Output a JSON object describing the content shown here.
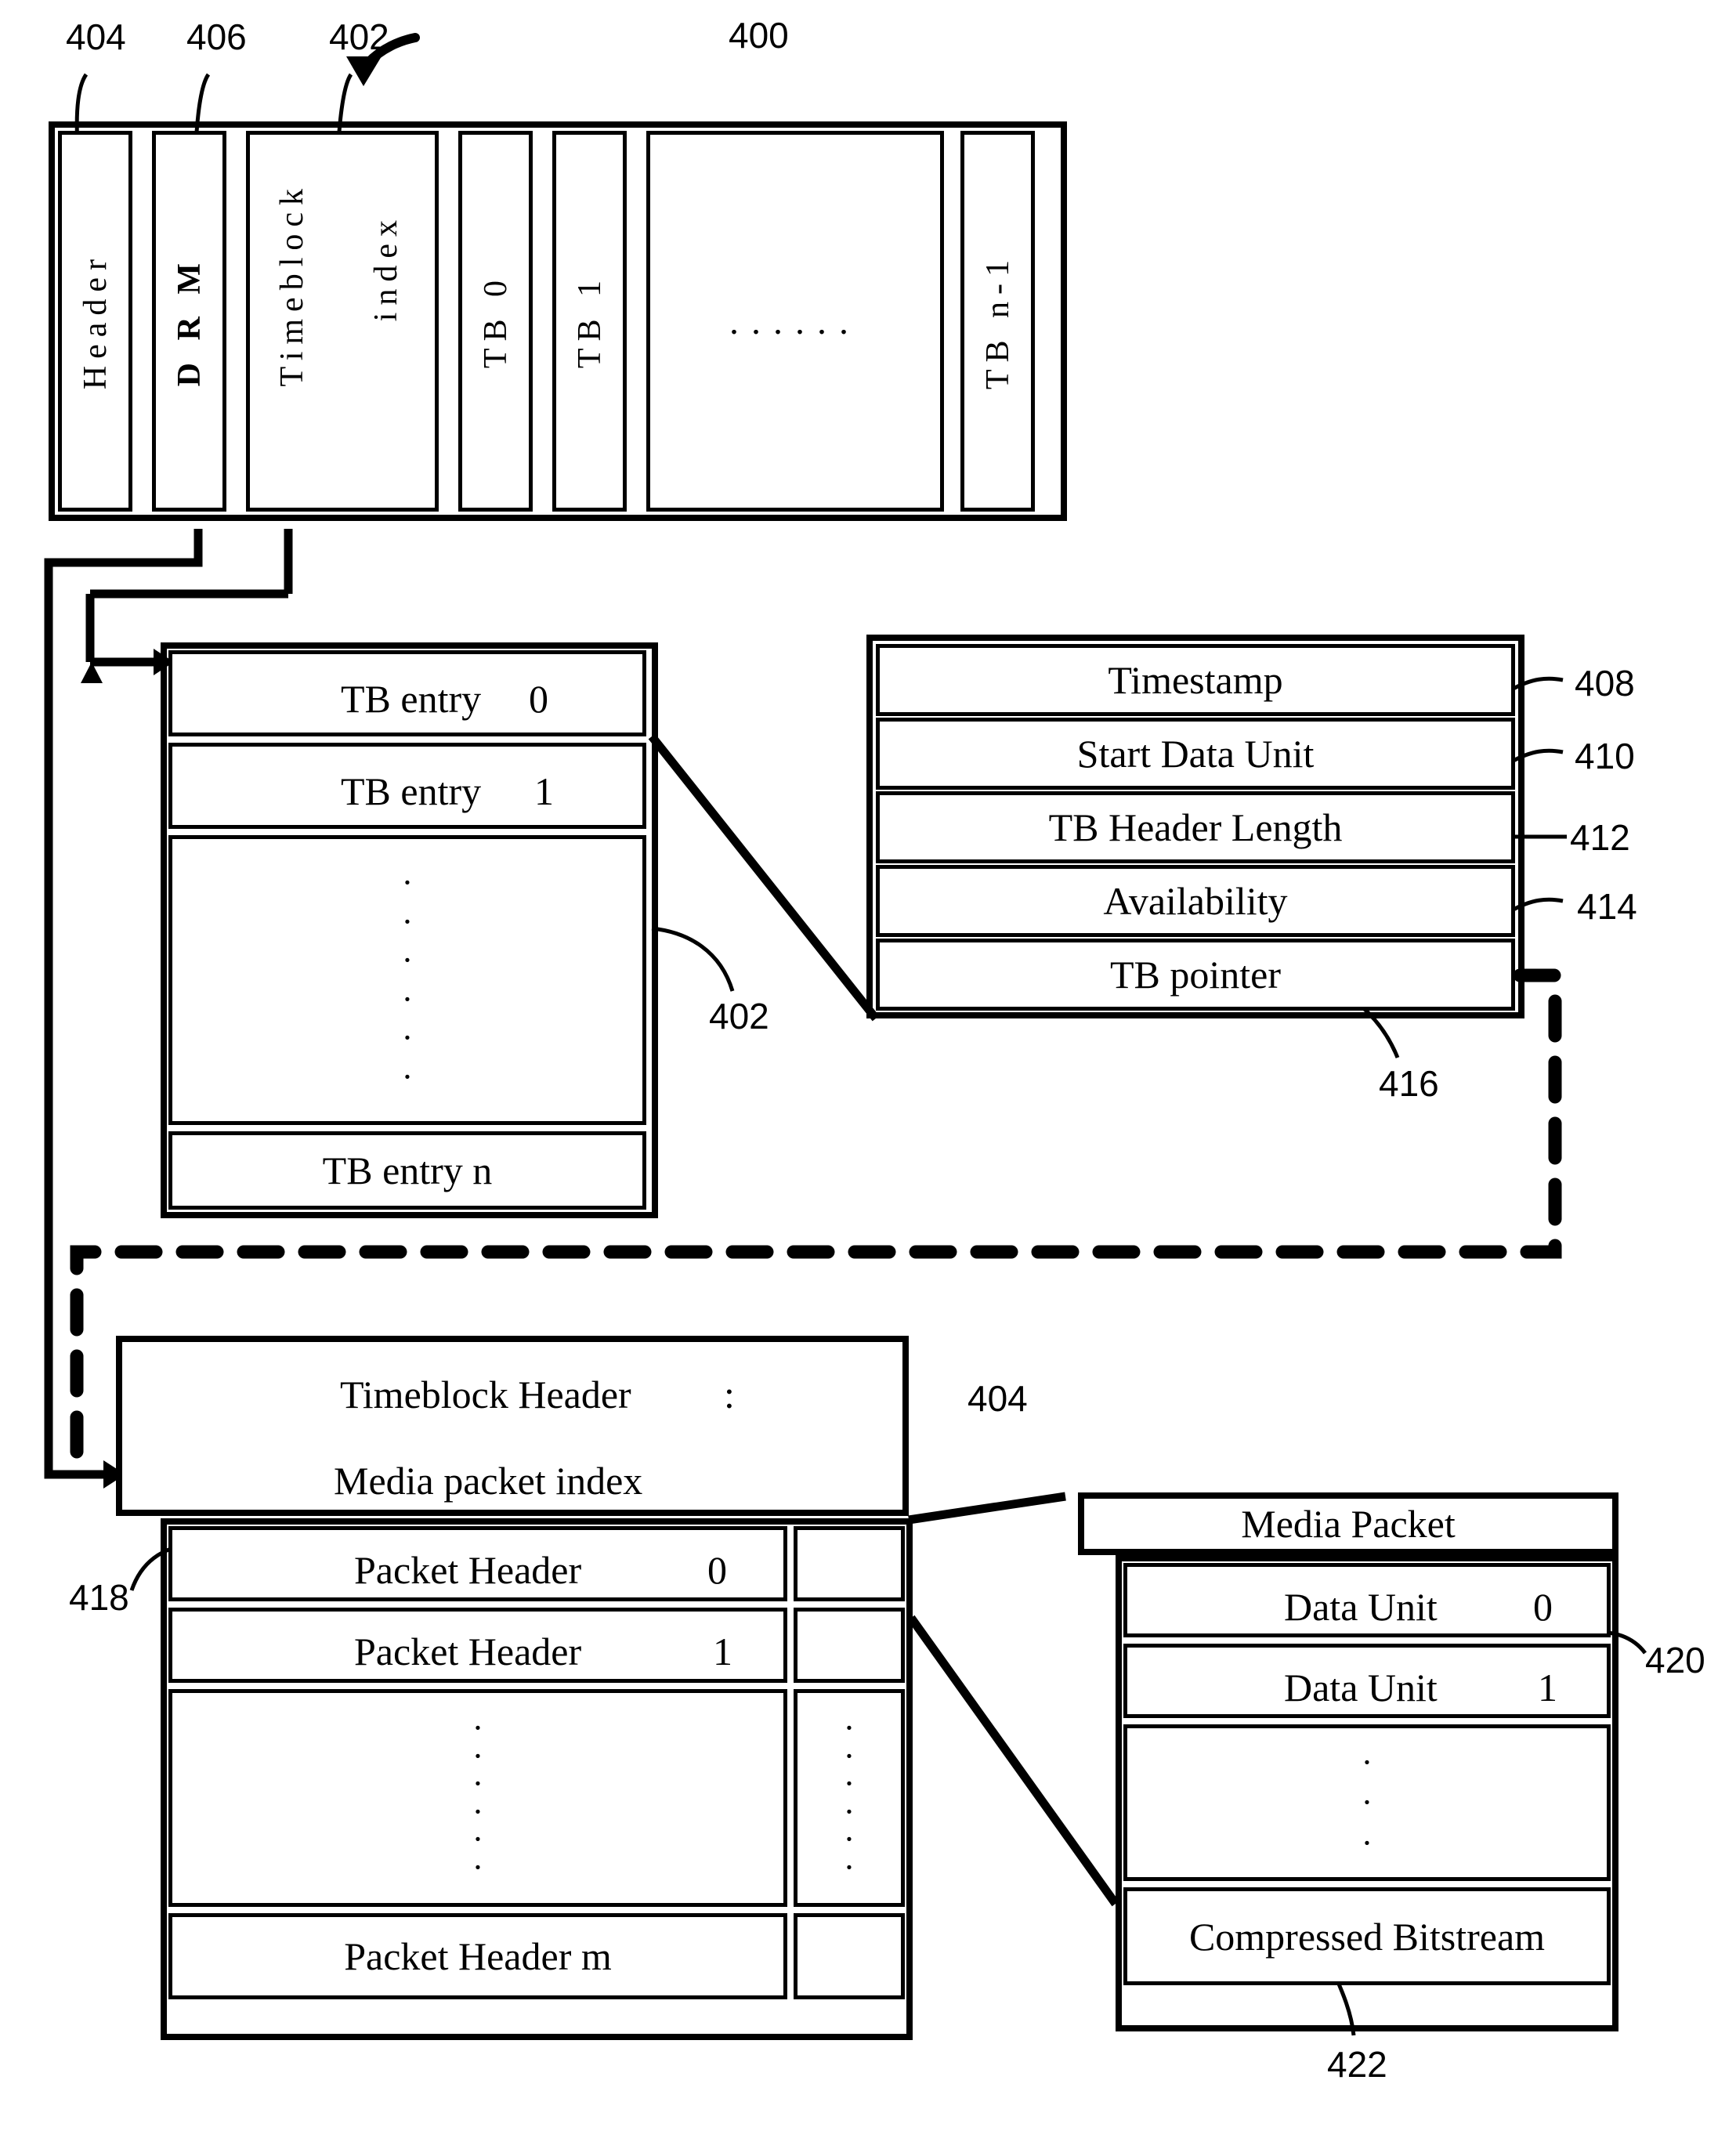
{
  "figure": {
    "reference_numerals": {
      "n400": "400",
      "n402": "402",
      "n404": "404",
      "n406": "406",
      "n408": "408",
      "n410": "410",
      "n412": "412",
      "n414": "414",
      "n416": "416",
      "n418": "418",
      "n420": "420",
      "n422": "422"
    }
  },
  "stream_container": {
    "ref": "400",
    "cells": [
      {
        "label": "Header",
        "ref": "404"
      },
      {
        "label": "D R M",
        "ref": "406"
      },
      {
        "label": "Timeblock",
        "ref": "402"
      },
      {
        "label": "index",
        "ref": ""
      },
      {
        "label": "TB 0",
        "ref": ""
      },
      {
        "label": "TB 1",
        "ref": ""
      },
      {
        "label": "......",
        "ref": ""
      },
      {
        "label": "TB n-1",
        "ref": ""
      }
    ]
  },
  "tb_index_table": {
    "ref": "402",
    "rows": [
      {
        "name": "TB entry",
        "index": "0"
      },
      {
        "name": "TB entry",
        "index": "1"
      },
      {
        "name": "",
        "index": ""
      },
      {
        "name": "TB entry n",
        "index": ""
      }
    ],
    "vertical_dots": "·"
  },
  "tb_entry_detail": {
    "rows": [
      {
        "label": "Timestamp",
        "ref": "408"
      },
      {
        "label": "Start Data Unit",
        "ref": "410"
      },
      {
        "label": "TB Header Length",
        "ref": "412"
      },
      {
        "label": "Availability",
        "ref": "414"
      },
      {
        "label": "TB pointer",
        "ref": "416"
      }
    ]
  },
  "timeblock": {
    "ref": "404",
    "header_label": "Timeblock Header",
    "header_colon": ":",
    "index_label": "Media packet index",
    "packet_index_ref": "418",
    "packet_rows": [
      {
        "name": "Packet Header",
        "index": "0"
      },
      {
        "name": "Packet Header",
        "index": "1"
      },
      {
        "name": "",
        "index": ""
      },
      {
        "name": "Packet Header m",
        "index": ""
      }
    ]
  },
  "media_packet": {
    "title": "Media Packet",
    "rows": [
      {
        "label": "Data Unit",
        "index": "0",
        "ref": "420"
      },
      {
        "label": "Data Unit",
        "index": "1",
        "ref": ""
      },
      {
        "label": "",
        "index": "",
        "ref": ""
      },
      {
        "label": "Compressed Bitstream",
        "index": "",
        "ref": "422"
      }
    ]
  },
  "colors": {
    "line": "#000000",
    "background": "#ffffff"
  }
}
